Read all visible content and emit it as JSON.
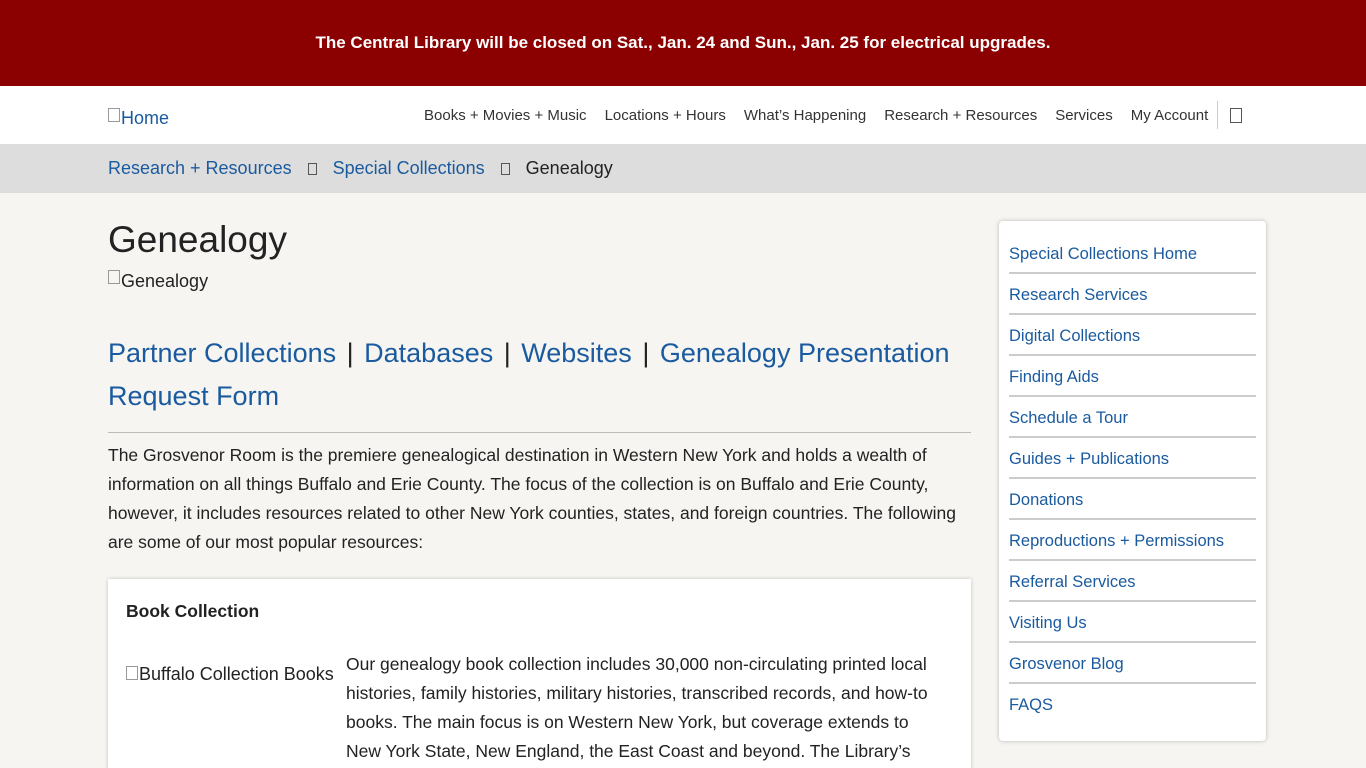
{
  "alert": {
    "text": "The Central Library will be closed on Sat., Jan. 24 and Sun., Jan. 25 for electrical upgrades."
  },
  "header": {
    "home_alt": "Home",
    "nav": [
      {
        "label": "Books + Movies + Music"
      },
      {
        "label": "Locations + Hours"
      },
      {
        "label": "What’s Happening"
      },
      {
        "label": "Research + Resources"
      },
      {
        "label": "Services"
      },
      {
        "label": "My Account"
      }
    ]
  },
  "breadcrumb": {
    "items": [
      {
        "label": "Research + Resources"
      },
      {
        "label": "Special Collections"
      }
    ],
    "current": "Genealogy"
  },
  "main": {
    "title": "Genealogy",
    "title_img_alt": "Genealogy",
    "jump_links": [
      {
        "label": "Partner Collections"
      },
      {
        "label": "Databases"
      },
      {
        "label": "Websites"
      },
      {
        "label": "Genealogy Presentation Request Form"
      }
    ],
    "intro": "The Grosvenor Room is the premiere genealogical destination in Western New York and holds a wealth of information on all things Buffalo and Erie County. The focus of the collection is on Buffalo and Erie County, however, it includes resources related to other New York counties, states, and foreign countries. The following are some of our most popular resources:",
    "card": {
      "title": "Book Collection",
      "img_alt": "Buffalo Collection Books",
      "text": "Our genealogy book collection includes 30,000 non-circulating printed local histories, family histories, military histories, transcribed records, and how-to books. The main focus is on Western New York, but coverage extends to New York State, New England, the East Coast and beyond.  The Library’s"
    }
  },
  "sidebar": {
    "links": [
      {
        "label": "Special Collections Home"
      },
      {
        "label": "Research Services"
      },
      {
        "label": "Digital Collections"
      },
      {
        "label": "Finding Aids"
      },
      {
        "label": "Schedule a Tour"
      },
      {
        "label": "Guides + Publications"
      },
      {
        "label": "Donations"
      },
      {
        "label": "Reproductions + Permissions"
      },
      {
        "label": "Referral Services"
      },
      {
        "label": "Visiting Us"
      },
      {
        "label": "Grosvenor Blog"
      },
      {
        "label": "FAQS"
      }
    ]
  },
  "colors": {
    "alert_bg": "#8b0000",
    "link": "#1a5a9e",
    "breadcrumb_bg": "#dddddd",
    "page_bg": "#f7f5f2"
  }
}
